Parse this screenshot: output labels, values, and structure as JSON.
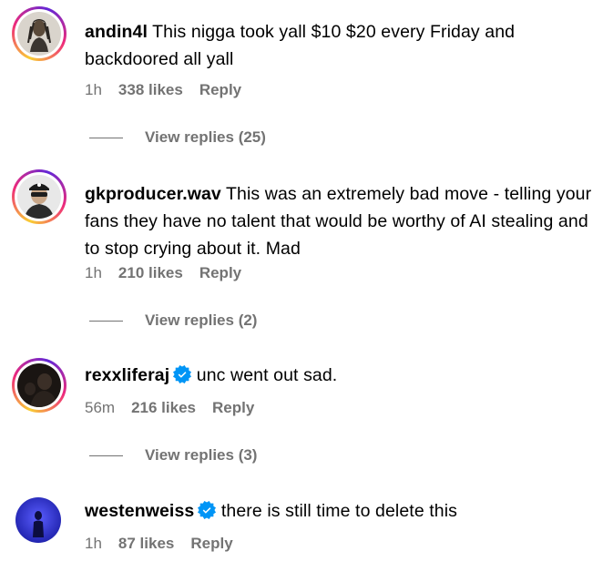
{
  "comments": [
    {
      "username": "andin4l",
      "text": "This nigga took yall $10 $20 every Friday and backdoored all yall",
      "time": "1h",
      "likes": "338 likes",
      "reply": "Reply",
      "view_replies": "View replies (25)",
      "verified": false
    },
    {
      "username": "gkproducer.wav",
      "text": "This was an extremely bad move - telling your fans they have no talent that would be worthy of AI stealing and to stop crying about it. Mad",
      "time": "1h",
      "likes": "210 likes",
      "reply": "Reply",
      "view_replies": "View replies (2)",
      "verified": false
    },
    {
      "username": "rexxliferaj",
      "text": "unc went out sad.",
      "time": "56m",
      "likes": "216 likes",
      "reply": "Reply",
      "view_replies": "View replies (3)",
      "verified": true
    },
    {
      "username": "westenweiss",
      "text": "there is still time to delete this",
      "time": "1h",
      "likes": "87 likes",
      "reply": "Reply",
      "verified": true
    }
  ],
  "colors": {
    "meta_gray": "#737373",
    "verified_blue": "#0095f6",
    "ring_gradient": [
      "#f9ce34",
      "#ee2a7b",
      "#6228d7"
    ]
  }
}
